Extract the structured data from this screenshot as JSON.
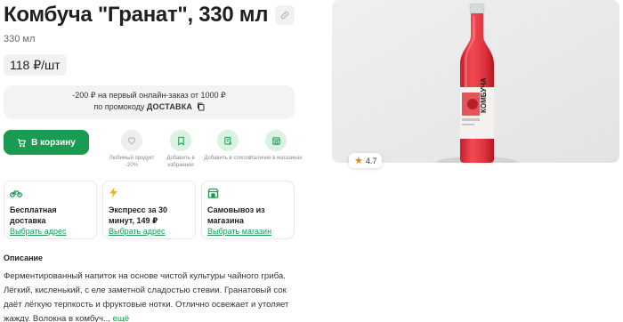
{
  "product": {
    "title": "Комбуча \"Гранат\", 330 мл",
    "volume": "330 мл",
    "price": "118 ₽/шт",
    "rating": "4.7"
  },
  "promo": {
    "line1": "-200 ₽ на первый онлайн-заказ от 1000 ₽",
    "line2_prefix": "по промокоду",
    "code": "ДОСТАВКА"
  },
  "cart_button": {
    "label": "В корзину"
  },
  "actions": [
    {
      "icon": "heart-icon",
      "label": "Любимый продукт -20%"
    },
    {
      "icon": "bookmark-icon",
      "label": "Добавить в избранное"
    },
    {
      "icon": "add-list-icon",
      "label": "Добавить в список."
    },
    {
      "icon": "store-icon",
      "label": "Наличие в магазинах"
    }
  ],
  "delivery": [
    {
      "icon": "bike-icon",
      "title": "Бесплатная доставка",
      "link": "Выбрать адрес"
    },
    {
      "icon": "bolt-icon",
      "title": "Экспресс за 30 минут, 149 ₽",
      "link": "Выбрать адрес"
    },
    {
      "icon": "shop-icon",
      "title": "Самовывоз из магазина",
      "link": "Выбрать магазин"
    }
  ],
  "description": {
    "title": "Описание",
    "text": "Ферментированный напиток на основе чистой культуры чайного гриба. Лёгкий, кисленький, с еле заметной сладостью стевии. Гранатовый сок даёт лёгкую терпкость и фруктовые нотки. Отлично освежает и утоляет жажду. Волокна в комбуч...",
    "more": " ещё"
  },
  "bottle_label": {
    "brand": "КОМБУЧА"
  },
  "colors": {
    "accent": "#1a9b52",
    "accent_light": "#dbf1e2",
    "star": "#e67e22",
    "drink": "#e0353e"
  }
}
